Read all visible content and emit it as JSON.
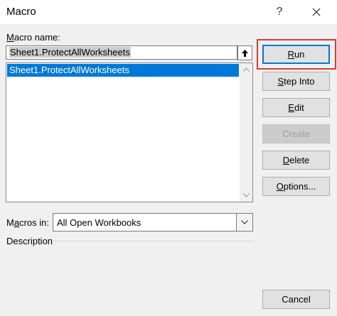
{
  "window": {
    "title": "Macro",
    "help_label": "?"
  },
  "macro_name": {
    "label_prefix": "",
    "label_mnemonic": "M",
    "label_rest": "acro name:",
    "value": "Sheet1.ProtectAllWorksheets"
  },
  "macro_list": {
    "items": [
      "Sheet1.ProtectAllWorksheets"
    ],
    "selected_index": 0
  },
  "buttons": {
    "run": {
      "pre": "",
      "mn": "R",
      "post": "un"
    },
    "step_into": {
      "pre": "",
      "mn": "S",
      "post": "tep Into"
    },
    "edit": {
      "pre": "",
      "mn": "E",
      "post": "dit"
    },
    "create": {
      "pre": "Create",
      "mn": "",
      "post": ""
    },
    "delete": {
      "pre": "",
      "mn": "D",
      "post": "elete"
    },
    "options": {
      "pre": "",
      "mn": "O",
      "post": "ptions..."
    },
    "cancel": "Cancel"
  },
  "macros_in": {
    "label_pre": "M",
    "label_mn": "a",
    "label_post": "cros in:",
    "selected": "All Open Workbooks"
  },
  "description": {
    "label": "Description"
  },
  "colors": {
    "accent": "#0078d7",
    "highlight": "#d23c3c"
  }
}
